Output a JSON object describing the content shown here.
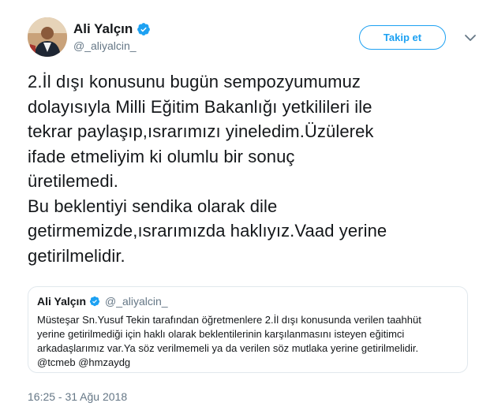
{
  "author": {
    "name": "Ali Yalçın",
    "handle": "@_aliyalcin_",
    "verified_icon": "verified-badge-icon"
  },
  "follow_button": {
    "label": "Takip et"
  },
  "menu": {
    "icon": "chevron-down-icon"
  },
  "tweet": {
    "text_lines": [
      "2.İl dışı konusunu bugün sempozyumumuz",
      "dolayısıyla Milli Eğitim Bakanlığı yetkilileri ile",
      "tekrar paylaşıp,ısrarımızı yineledim.Üzülerek",
      "ifade etmeliyim ki olumlu bir sonuç",
      "üretilemedi.",
      "Bu beklentiyi sendika olarak dile",
      "getirmemizde,ısrarımızda haklıyız.Vaad yerine",
      "getirilmelidir."
    ]
  },
  "quote": {
    "name": "Ali Yalçın",
    "handle": "@_aliyalcin_",
    "text_lines": [
      "Müsteşar Sn.Yusuf Tekin tarafından öğretmenlere 2.İl dışı konusunda verilen taahhüt",
      "yerine getirilmediği için haklı olarak beklentilerinin karşılanmasını isteyen eğitimci",
      "arkadaşlarımız var.Ya söz verilmemeli ya da verilen söz mutlaka yerine getirilmelidir.",
      "@tcmeb @hmzaydg"
    ]
  },
  "timestamp": "16:25 - 31 Ağu 2018",
  "colors": {
    "accent": "#1da1f2",
    "text": "#14171a",
    "muted": "#657786",
    "border": "#e1e8ed"
  }
}
